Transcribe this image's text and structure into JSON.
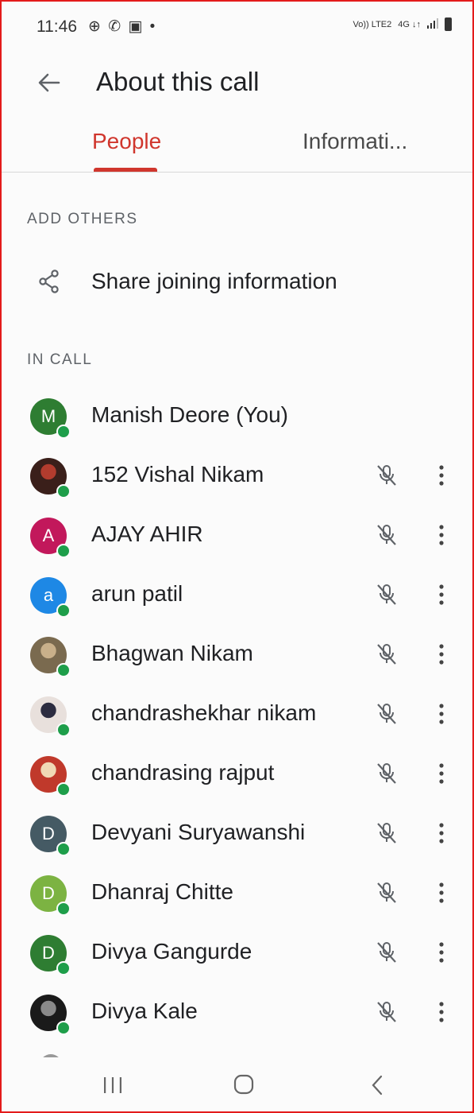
{
  "status_bar": {
    "time": "11:46",
    "notification_icons": [
      "whatsapp-business-icon",
      "whatsapp-icon",
      "gallery-icon"
    ],
    "dot": "•",
    "network_volte": "Vo)) LTE2",
    "network_4g": "4G ↓↑"
  },
  "appbar": {
    "title": "About this call"
  },
  "tabs": [
    {
      "label": "People",
      "active": true
    },
    {
      "label": "Informati..."
    }
  ],
  "add_others": {
    "header": "ADD OTHERS",
    "share_label": "Share joining information"
  },
  "in_call": {
    "header": "IN CALL",
    "participants": [
      {
        "name": "Manish Deore (You)",
        "initial": "M",
        "avatar": "letter",
        "color": "#2e7d32",
        "self": true
      },
      {
        "name": "152 Vishal Nikam",
        "avatar": "photo",
        "photo_colors": [
          "#3a1f1a",
          "#b23c2e"
        ]
      },
      {
        "name": "AJAY AHIR",
        "initial": "A",
        "avatar": "letter",
        "color": "#c2185b"
      },
      {
        "name": "arun patil",
        "initial": "a",
        "avatar": "letter",
        "color": "#1e88e5"
      },
      {
        "name": "Bhagwan Nikam",
        "avatar": "photo",
        "photo_colors": [
          "#7a6a4f",
          "#c9b08a"
        ]
      },
      {
        "name": "chandrashekhar nikam",
        "avatar": "photo",
        "photo_colors": [
          "#e8e0dc",
          "#2c2c40"
        ]
      },
      {
        "name": "chandrasing rajput",
        "avatar": "photo",
        "photo_colors": [
          "#c0392b",
          "#f0d9b5"
        ]
      },
      {
        "name": "Devyani Suryawanshi",
        "initial": "D",
        "avatar": "letter",
        "color": "#455a64"
      },
      {
        "name": "Dhanraj Chitte",
        "initial": "D",
        "avatar": "letter",
        "color": "#7cb342"
      },
      {
        "name": "Divya Gangurde",
        "initial": "D",
        "avatar": "letter",
        "color": "#2e7d32"
      },
      {
        "name": "Divya Kale",
        "avatar": "photo",
        "photo_colors": [
          "#1a1a1a",
          "#8a8a8a"
        ]
      }
    ]
  },
  "colors": {
    "accent": "#d0362d",
    "online": "#1e9e4a",
    "frame": "#e31b1b"
  }
}
